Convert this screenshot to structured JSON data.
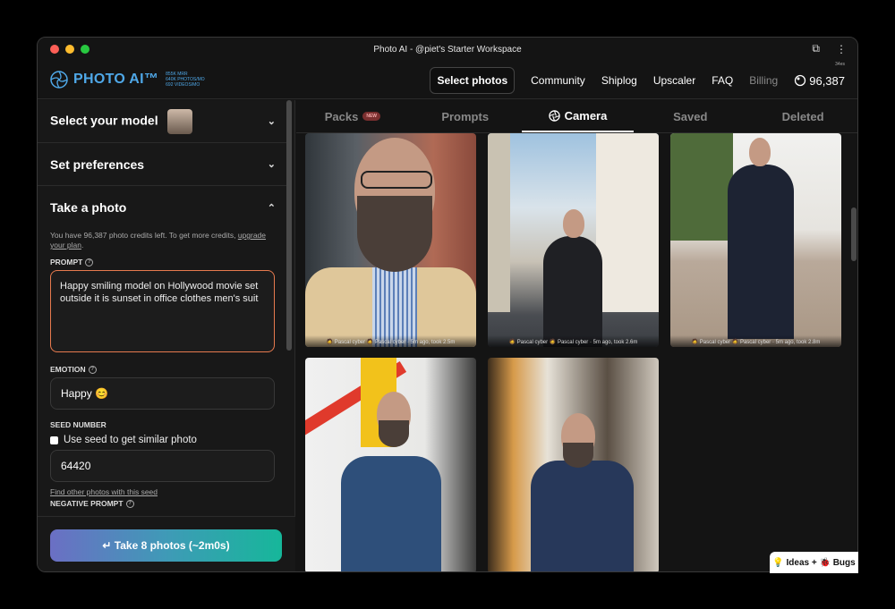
{
  "window": {
    "title": "Photo AI - @piet's Starter Workspace"
  },
  "header": {
    "logo_text": "PHOTO AI™",
    "logo_stats": [
      "855K MRR",
      "640K PHOTOS/MO",
      "692 VIDEOS/MO"
    ],
    "nav": {
      "select_photos": "Select photos",
      "community": "Community",
      "shiplog": "Shiplog",
      "upscaler": "Upscaler",
      "faq": "FAQ",
      "billing": "Billing",
      "credits": "96,387",
      "credits_tiny": "34es"
    }
  },
  "sidebar": {
    "select_model": "Select your model",
    "set_preferences": "Set preferences",
    "take_photo": "Take a photo",
    "credits_note": "You have 96,387 photo credits left. To get more credits,",
    "upgrade_link": "upgrade your plan",
    "prompt_label": "PROMPT",
    "prompt_value": "Happy smiling model on Hollywood movie set outside it is sunset in office clothes men's suit",
    "emotion_label": "EMOTION",
    "emotion_value": "Happy 😊",
    "seed_label": "SEED NUMBER",
    "seed_checkbox": "Use seed to get similar photo",
    "seed_value": "64420",
    "seed_link": "Find other photos with this seed",
    "negative_label": "NEGATIVE PROMPT",
    "take_button": "↵ Take 8 photos (~2m0s)"
  },
  "tabs": [
    {
      "label": "Packs",
      "badge": "NEW"
    },
    {
      "label": "Prompts"
    },
    {
      "label": "Camera",
      "active": true
    },
    {
      "label": "Saved"
    },
    {
      "label": "Deleted"
    }
  ],
  "photos": [
    {
      "caption": "🧔 Pascal cyber 🧔 Pascal cyber · 5m ago, took 2.5m"
    },
    {
      "caption": "🧔 Pascal cyber 🧔 Pascal cyber · 5m ago, took 2.6m"
    },
    {
      "caption": "🧔 Pascal cyber 🧔 Pascal cyber · 5m ago, took 2.8m"
    },
    {
      "caption": ""
    },
    {
      "caption": ""
    }
  ],
  "ideas_button": "💡 Ideas + 🐞 Bugs",
  "colors": {
    "accent_blue": "#4fa8e8",
    "prompt_border": "#e77a4e",
    "button_start": "#6b6fc4",
    "button_end": "#16b79a"
  }
}
